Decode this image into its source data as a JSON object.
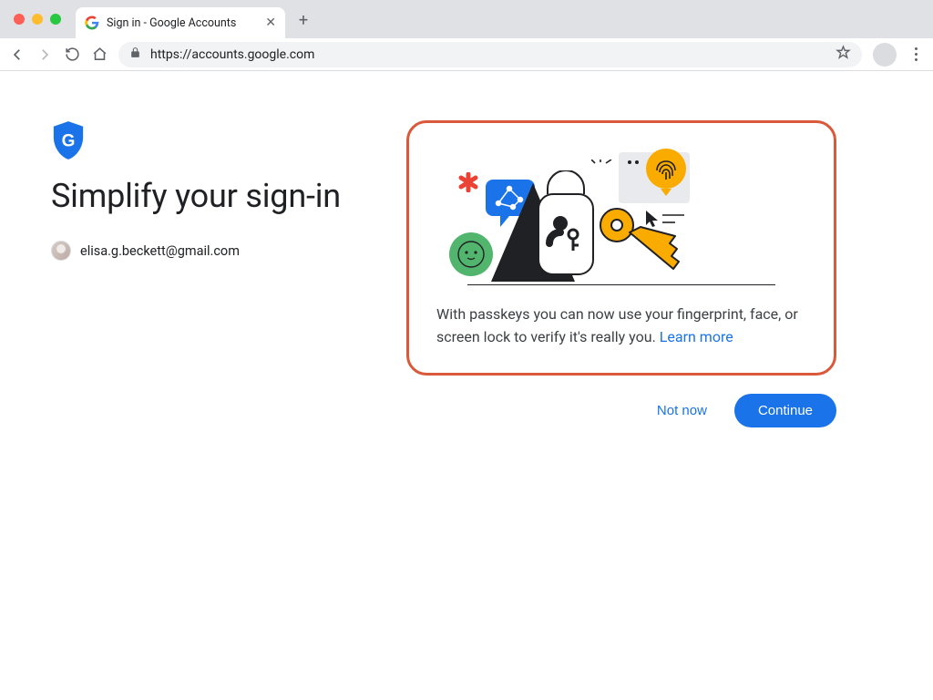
{
  "browser": {
    "tab_title": "Sign in - Google Accounts",
    "url": "https://accounts.google.com"
  },
  "page": {
    "title": "Simplify your sign-in",
    "account_email": "elisa.g.beckett@gmail.com"
  },
  "card": {
    "body_text": "With passkeys you can now use your fingerprint, face, or screen lock to verify it's really you. ",
    "learn_more_label": "Learn more"
  },
  "actions": {
    "secondary": "Not now",
    "primary": "Continue"
  },
  "colors": {
    "accent": "#1a73e8",
    "highlight_border": "#d9593a"
  }
}
